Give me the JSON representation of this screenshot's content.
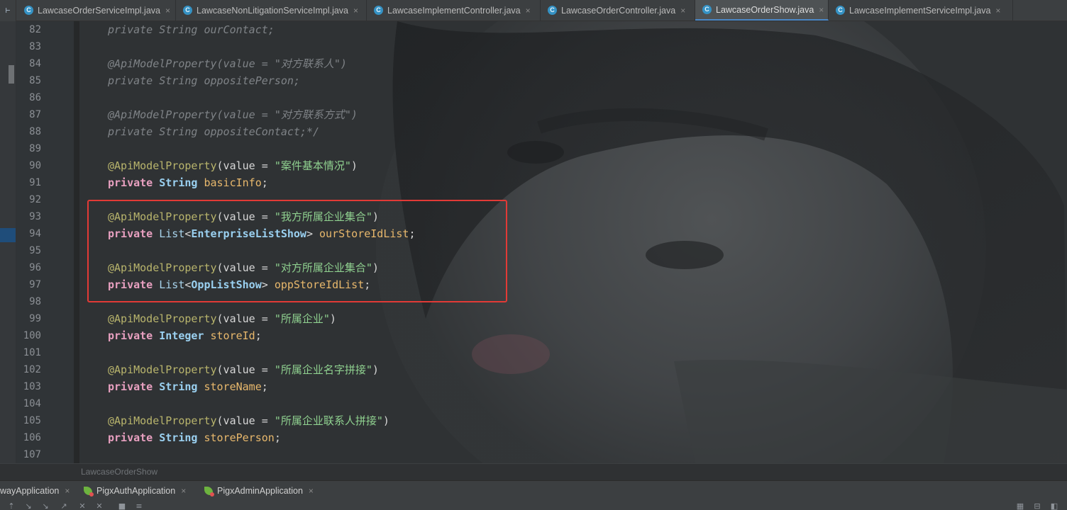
{
  "tabs": [
    {
      "label": "LawcaseOrderServiceImpl.java",
      "active": false
    },
    {
      "label": "LawcaseNonLitigationServiceImpl.java",
      "active": false
    },
    {
      "label": "LawcaseImplementController.java",
      "active": false
    },
    {
      "label": "LawcaseOrderController.java",
      "active": false
    },
    {
      "label": "LawcaseOrderShow.java",
      "active": true
    },
    {
      "label": "LawcaseImplementServiceImpl.java",
      "active": false
    }
  ],
  "tab_icon_letter": "C",
  "close_glyph": "×",
  "left_strip_label": "⊢",
  "editor": {
    "line_numbers": [
      "82",
      "83",
      "84",
      "85",
      "86",
      "87",
      "88",
      "89",
      "90",
      "91",
      "92",
      "93",
      "94",
      "95",
      "96",
      "97",
      "98",
      "99",
      "100",
      "101",
      "102",
      "103",
      "104",
      "105",
      "106",
      "107"
    ],
    "lines": {
      "l82": {
        "kw": "private",
        "type": "String",
        "field": "ourContact;"
      },
      "l84": {
        "ann": "@ApiModelProperty",
        "args_open": "(value = ",
        "str": "\"对方联系人\"",
        "args_close": ")"
      },
      "l85": {
        "kw": "private",
        "type": "String",
        "field": "oppositePerson;"
      },
      "l87": {
        "ann": "@ApiModelProperty",
        "args_open": "(value = ",
        "str": "\"对方联系方式\"",
        "args_close": ")"
      },
      "l88": {
        "kw": "private",
        "type": "String",
        "field": "oppositeContact;*/"
      },
      "l90": {
        "ann": "@ApiModelProperty",
        "args_open": "(value = ",
        "str": "\"案件基本情况\"",
        "args_close": ")"
      },
      "l91": {
        "kw": "private",
        "type": "String",
        "field": "basicInfo",
        "end": ";"
      },
      "l93": {
        "ann": "@ApiModelProperty",
        "args_open": "(value = ",
        "str": "\"我方所属企业集合\"",
        "args_close": ")"
      },
      "l94": {
        "kw": "private",
        "type": "List",
        "lt": "<",
        "generic": "EnterpriseListShow",
        "gt": ">",
        "field": "ourStoreIdList",
        "end": ";"
      },
      "l96": {
        "ann": "@ApiModelProperty",
        "args_open": "(value = ",
        "str": "\"对方所属企业集合\"",
        "args_close": ")"
      },
      "l97": {
        "kw": "private",
        "type": "List",
        "lt": "<",
        "generic": "OppListShow",
        "gt": ">",
        "field": "oppStoreIdList",
        "end": ";"
      },
      "l99": {
        "ann": "@ApiModelProperty",
        "args_open": "(value = ",
        "str": "\"所属企业\"",
        "args_close": ")"
      },
      "l100": {
        "kw": "private",
        "type": "Integer",
        "field": "storeId",
        "end": ";"
      },
      "l102": {
        "ann": "@ApiModelProperty",
        "args_open": "(value = ",
        "str": "\"所属企业名字拼接\"",
        "args_close": ")"
      },
      "l103": {
        "kw": "private",
        "type": "String",
        "field": "storeName",
        "end": ";"
      },
      "l105": {
        "ann": "@ApiModelProperty",
        "args_open": "(value = ",
        "str": "\"所属企业联系人拼接\"",
        "args_close": ")"
      },
      "l106": {
        "kw": "private",
        "type": "String",
        "field": "storePerson",
        "end": ";"
      }
    }
  },
  "breadcrumb": "LawcaseOrderShow",
  "run_tabs": [
    {
      "label": "wayApplication"
    },
    {
      "label": "PigxAuthApplication"
    },
    {
      "label": "PigxAdminApplication"
    }
  ],
  "toolbar_icons": [
    "align-top-icon",
    "arrow-down-icon",
    "arrow-down-right-icon",
    "arrow-up-right-icon",
    "cross-icon",
    "cross-icon",
    "stop-icon",
    "wrap-icon"
  ],
  "toolbar_glyphs": [
    "⇡",
    "↘",
    "↘",
    "↗",
    "✕",
    "✕",
    "■",
    "≡"
  ],
  "toolbar_right_glyphs": [
    "▦",
    "⊟",
    "◧"
  ],
  "colors": {
    "annotation": "#b8b46c",
    "keyword": "#e8a0c0",
    "type": "#9ad0f0",
    "field": "#e8b86c",
    "string": "#8fd08f",
    "comment": "#7f8387",
    "highlight_box": "#e23a36",
    "active_tab_underline": "#4a88c7"
  }
}
